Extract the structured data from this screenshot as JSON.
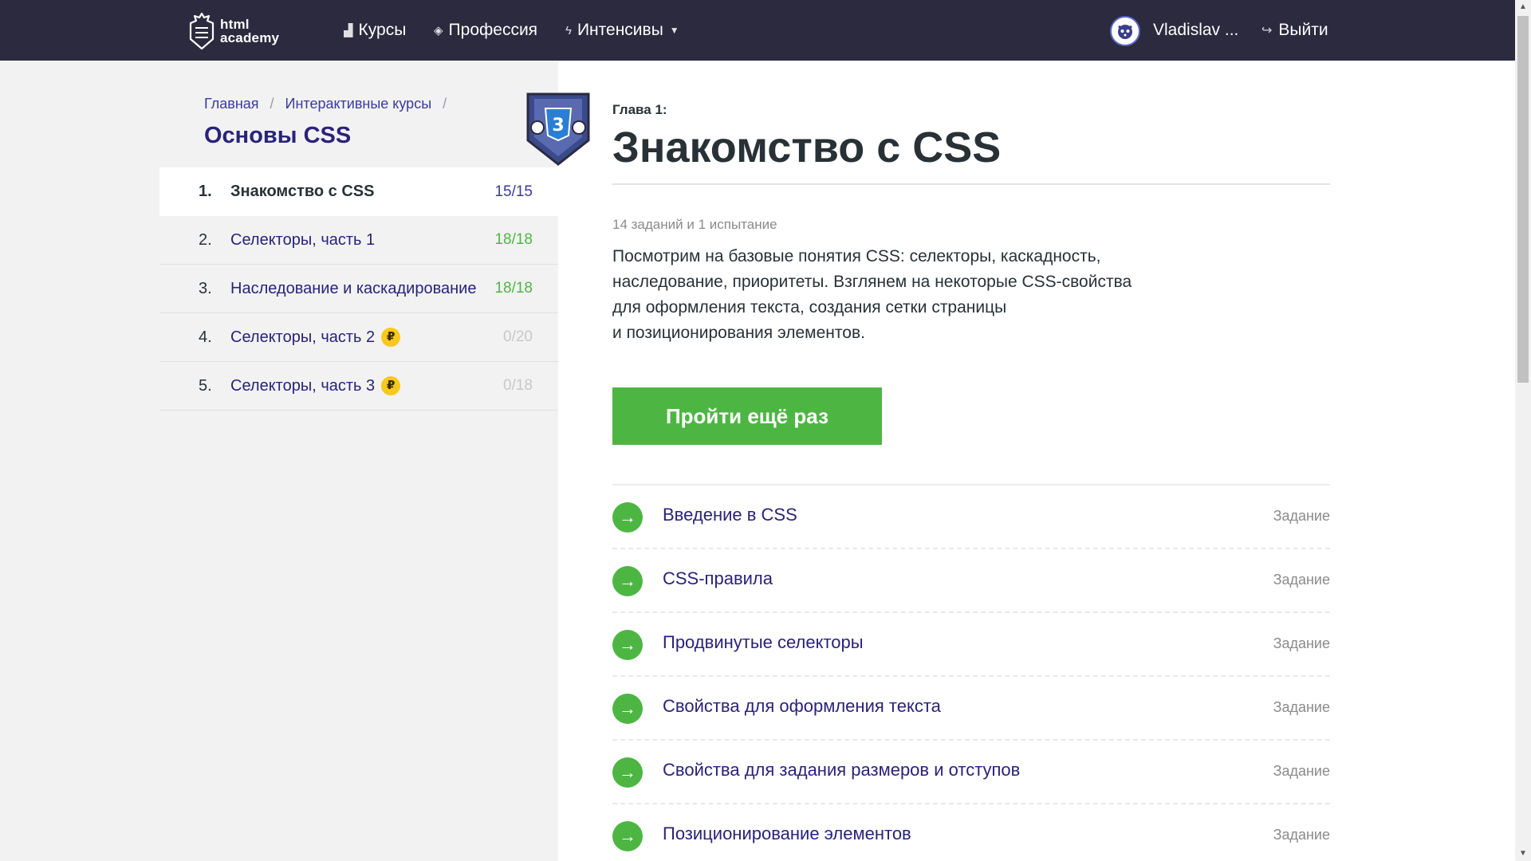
{
  "header": {
    "logo_line1": "html",
    "logo_line2": "academy",
    "nav": [
      {
        "label": "Курсы",
        "icon": "bar-chart-icon"
      },
      {
        "label": "Профессия",
        "icon": "graduation-cap-icon"
      },
      {
        "label": "Интенсивы",
        "icon": "lightning-icon"
      }
    ],
    "user_name": "Vladislav ...",
    "logout_label": "Выйти"
  },
  "sidebar": {
    "breadcrumbs": [
      "Главная",
      "Интерактивные курсы"
    ],
    "breadcrumb_separator": "/",
    "course_title": "Основы CSS",
    "chapters": [
      {
        "num": "1.",
        "title": "Знакомство с CSS",
        "progress": "15/15",
        "progress_color": "#3a3aa0",
        "paid": false,
        "active": true
      },
      {
        "num": "2.",
        "title": "Селекторы, часть 1",
        "progress": "18/18",
        "progress_color": "#4db643",
        "paid": false,
        "active": false
      },
      {
        "num": "3.",
        "title": "Наследование и каскадирование",
        "progress": "18/18",
        "progress_color": "#4db643",
        "paid": false,
        "active": false
      },
      {
        "num": "4.",
        "title": "Селекторы, часть 2",
        "progress": "0/20",
        "progress_color": "#c8c8c8",
        "paid": true,
        "active": false
      },
      {
        "num": "5.",
        "title": "Селекторы, часть 3",
        "progress": "0/18",
        "progress_color": "#c8c8c8",
        "paid": true,
        "active": false
      }
    ],
    "coin_symbol": "₽"
  },
  "main": {
    "chapter_label": "Глава 1:",
    "chapter_title": "Знакомство с CSS",
    "meta": "14 заданий и 1 испытание",
    "description": [
      "Посмотрим на базовые понятия CSS: селекторы, каскадность,",
      "наследование, приоритеты. Взглянем на некоторые CSS-свойства",
      "для оформления текста, создания сетки страницы",
      "и позиционирования элементов."
    ],
    "cta_label": "Пройти ещё раз",
    "lessons": [
      {
        "name": "Введение в CSS",
        "type": "Задание"
      },
      {
        "name": "CSS-правила",
        "type": "Задание"
      },
      {
        "name": "Продвинутые селекторы",
        "type": "Задание"
      },
      {
        "name": "Свойства для оформления текста",
        "type": "Задание"
      },
      {
        "name": "Свойства для задания размеров и отступов",
        "type": "Задание"
      },
      {
        "name": "Позиционирование элементов",
        "type": "Задание"
      }
    ]
  },
  "colors": {
    "header_bg": "#2b2a3e",
    "accent_green": "#4db643",
    "link_blue": "#28237a"
  }
}
